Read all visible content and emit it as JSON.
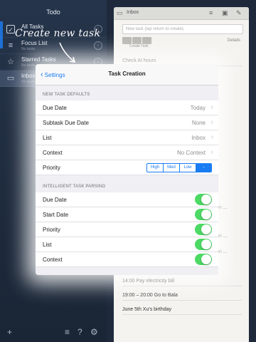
{
  "sidebar": {
    "title": "Todo",
    "items": [
      {
        "label": "All Tasks",
        "sub": "",
        "icon": "checkbox-icon"
      },
      {
        "label": "Focus List",
        "sub": "No tasks",
        "icon": "list-icon"
      },
      {
        "label": "Starred Tasks",
        "sub": "No tasks",
        "icon": "star-icon"
      },
      {
        "label": "Inbox",
        "sub": "No tasks",
        "icon": "inbox-icon"
      }
    ],
    "bottom_icons": [
      "add-icon",
      "menu-icon",
      "help-icon",
      "settings-icon"
    ]
  },
  "annotation": "Create new task",
  "inbox": {
    "title": "Inbox",
    "new_task_placeholder": "New task (tap return to create)",
    "create_task_label": "Create Task",
    "details_label": "Details",
    "lines": [
      "Check AI hours",
      "14:00    Pay electricity bill",
      "19:00 – 20:00    Go to Bala",
      "June 5th  Xu's birthday"
    ],
    "fragments": [
      "on ...",
      "on ...",
      "on ..."
    ]
  },
  "popover": {
    "back_label": "Settings",
    "title": "Task Creation",
    "section1_header": "NEW TASK DEFAULTS",
    "defaults": [
      {
        "label": "Due Date",
        "value": "Today"
      },
      {
        "label": "Subtask Due Date",
        "value": "None"
      },
      {
        "label": "List",
        "value": "Inbox"
      },
      {
        "label": "Context",
        "value": "No Context"
      }
    ],
    "priority_label": "Priority",
    "priority_options": [
      "High",
      "Med",
      "Low",
      "-"
    ],
    "priority_selected": "-",
    "section2_header": "INTELLIGENT TASK PARSING",
    "parsing": [
      {
        "label": "Due Date",
        "on": true
      },
      {
        "label": "Start Date",
        "on": true
      },
      {
        "label": "Priority",
        "on": true
      },
      {
        "label": "List",
        "on": true
      },
      {
        "label": "Context",
        "on": true
      }
    ]
  },
  "colors": {
    "accent": "#1a7cf2",
    "toggle_on": "#4cd964",
    "sidebar_bg": "#1e2a3c"
  }
}
